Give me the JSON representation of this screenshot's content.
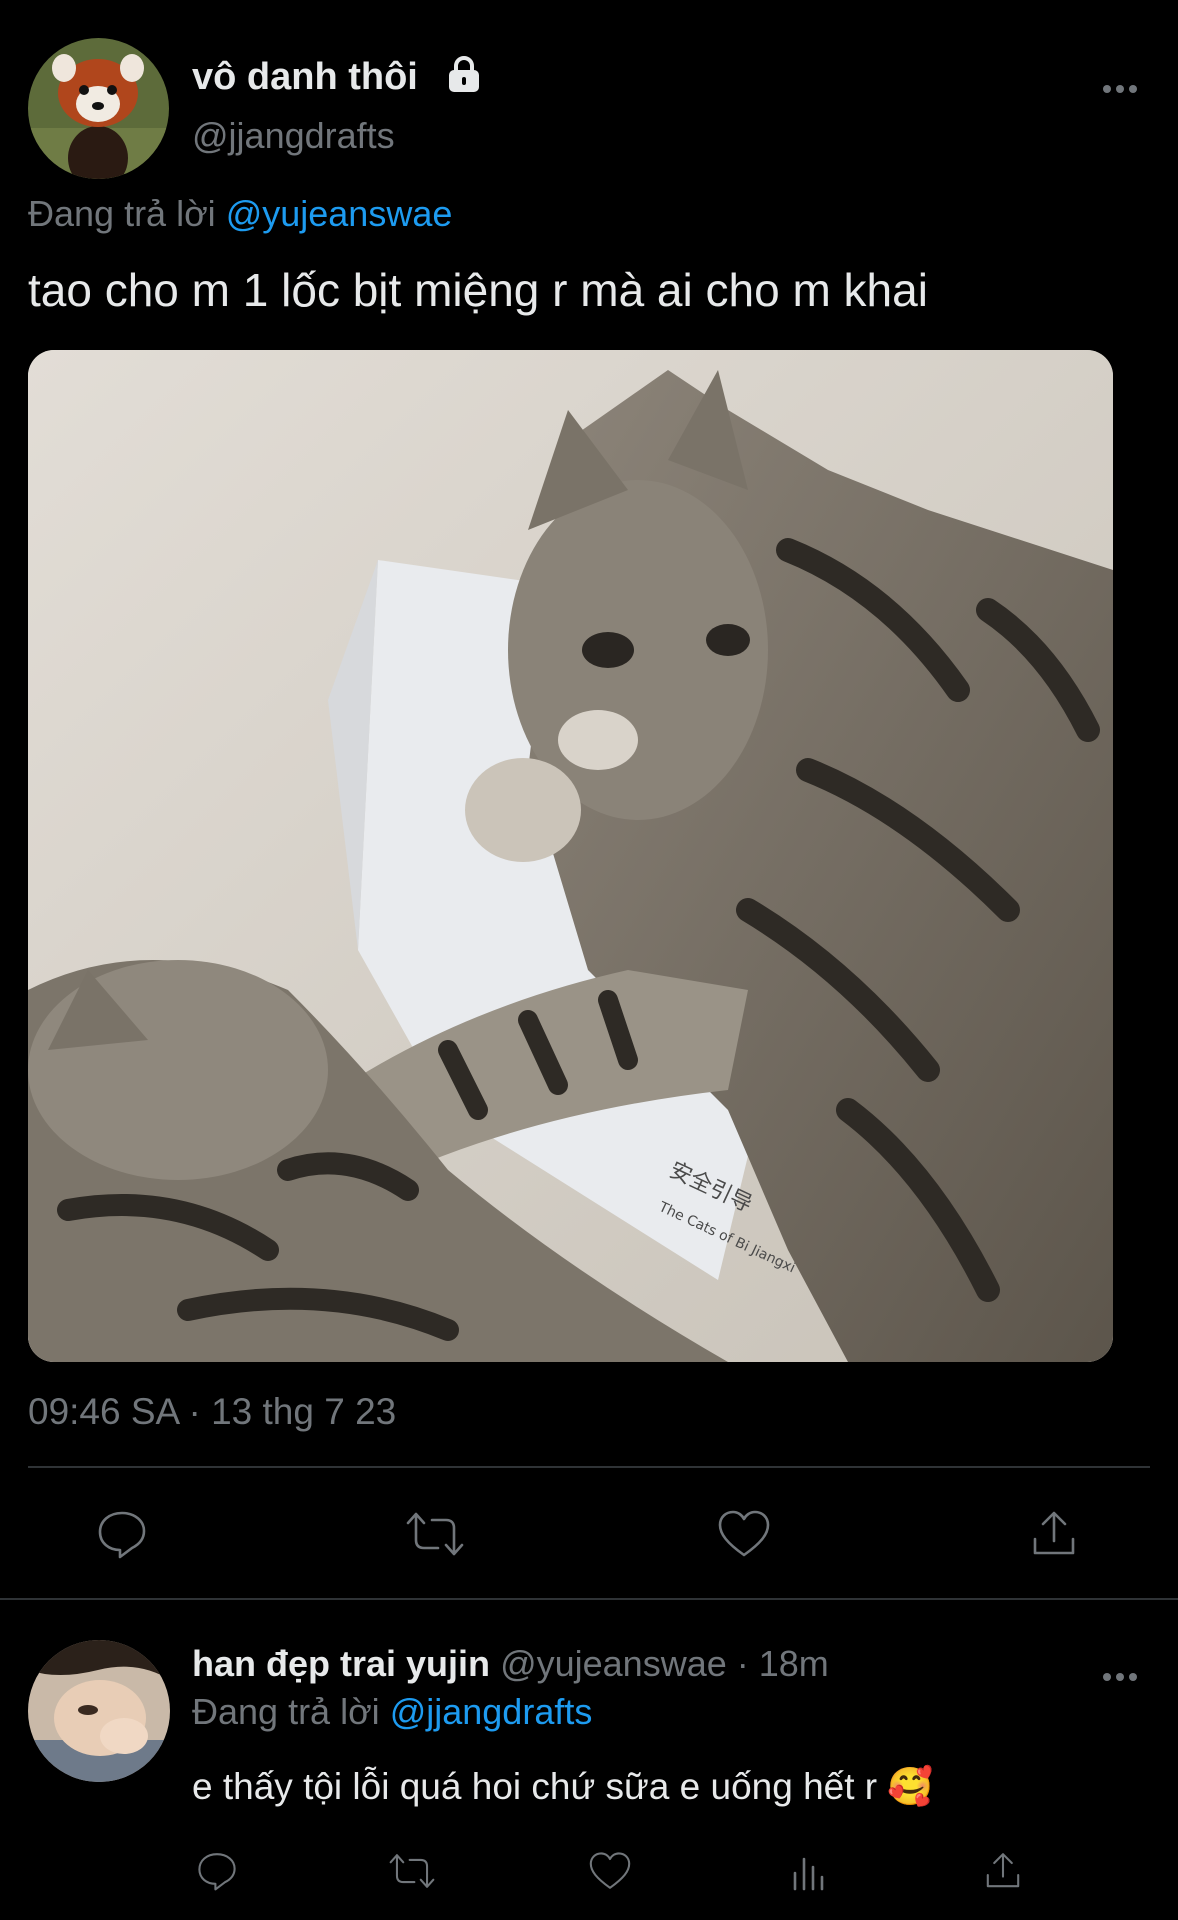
{
  "main_tweet": {
    "display_name": "vô danh thôi",
    "handle": "@jjangdrafts",
    "reply_prefix": "Đang trả lời",
    "reply_to": "@yujeanswae",
    "text": "tao cho m 1 lốc bịt miệng r mà ai cho m khai",
    "media_caption_lines": [
      "安全引导",
      "The Cats of Bi Jiangxi"
    ],
    "timestamp": "09:46 SA · 13 thg 7 23",
    "icons": [
      "lock-icon",
      "more-icon",
      "reply-icon",
      "retweet-icon",
      "like-icon",
      "share-icon"
    ]
  },
  "reply_tweet": {
    "display_name": "han đẹp trai yujin",
    "handle": "@yujeanswae",
    "separator": "·",
    "time_ago": "18m",
    "reply_prefix": "Đang trả lời",
    "reply_to": "@jjangdrafts",
    "text": "e thấy tội lỗi quá hoi chứ sữa e uống hết r",
    "emoji": "🥰",
    "icons": [
      "reply-icon",
      "retweet-icon",
      "like-icon",
      "views-icon",
      "share-icon"
    ]
  },
  "colors": {
    "background": "#000000",
    "text_primary": "#e7e9ea",
    "text_secondary": "#71767b",
    "link": "#1d9bf0",
    "divider": "#2f3336"
  }
}
